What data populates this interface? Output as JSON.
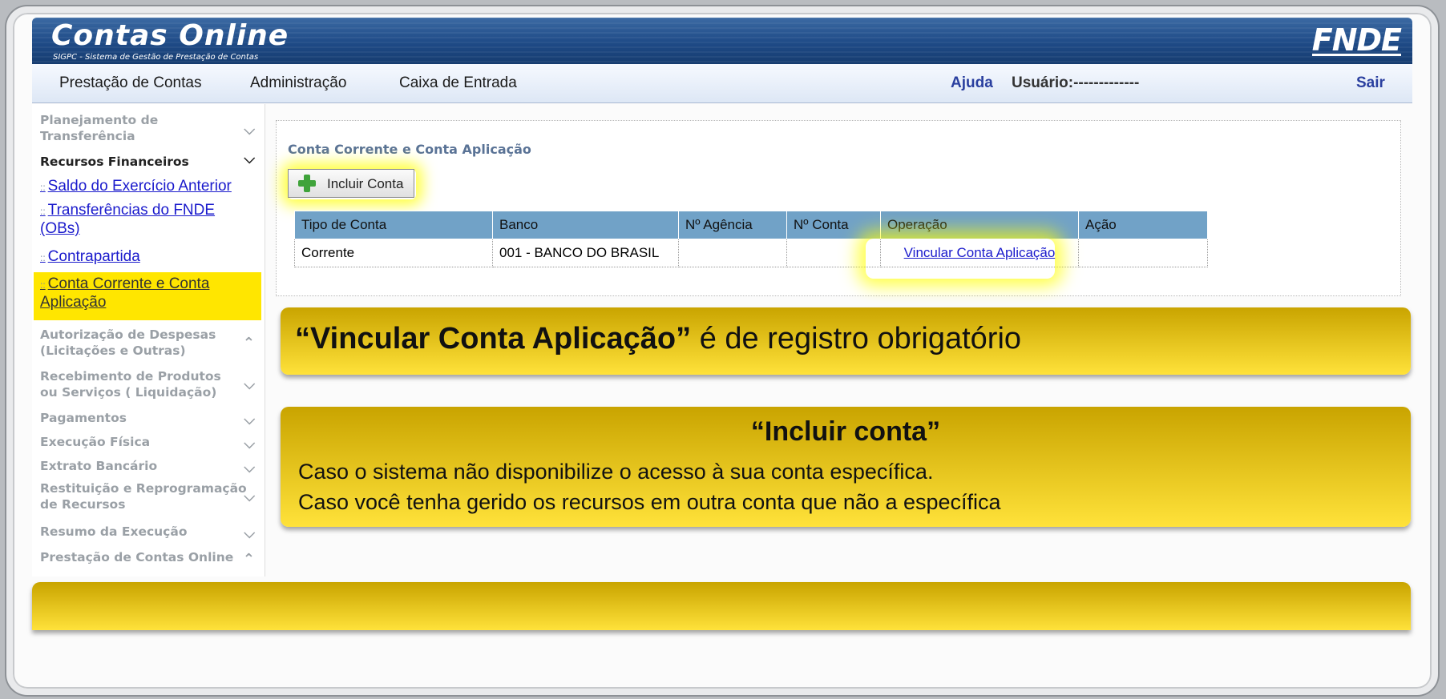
{
  "header": {
    "title": "Contas Online",
    "subtitle": "SIGPC - Sistema de Gestão de Prestação de Contas",
    "logo": "FNDE"
  },
  "menu": {
    "items": [
      "Prestação de Contas",
      "Administração",
      "Caixa de Entrada"
    ],
    "help": "Ajuda",
    "user_label": "Usuário:-------------",
    "logout": "Sair"
  },
  "sidebar": {
    "sections": [
      {
        "label": "Planejamento de Transferência",
        "icon": "chevron-double-down-icon"
      },
      {
        "label": "Recursos Financeiros",
        "icon": "chevron-double-down-icon"
      },
      {
        "label": "Autorização de Despesas (Licitações e Outras)",
        "icon": "chevron-double-up-icon"
      },
      {
        "label": "Recebimento de Produtos ou Serviços ( Liquidação)",
        "icon": "chevron-double-down-icon"
      },
      {
        "label": "Pagamentos",
        "icon": "chevron-double-down-icon"
      },
      {
        "label": "Execução Física",
        "icon": "chevron-double-down-icon"
      },
      {
        "label": "Extrato Bancário",
        "icon": "chevron-double-down-icon"
      },
      {
        "label": "Restituição e Reprogramação de Recursos",
        "icon": "chevron-double-down-icon"
      },
      {
        "label": "Resumo da Execução",
        "icon": "chevron-double-down-icon"
      },
      {
        "label": "Prestação de Contas Online",
        "icon": "chevron-double-up-icon"
      }
    ],
    "sub_items": [
      "Saldo do Exercício Anterior",
      "Transferências do FNDE (OBs)",
      "Contrapartida",
      "Conta Corrente e Conta Aplicação"
    ]
  },
  "content": {
    "title": "Conta Corrente e Conta Aplicação",
    "add_button": "Incluir Conta",
    "table": {
      "headers": [
        "Tipo de Conta",
        "Banco",
        "Nº Agência",
        "Nº Conta",
        "Operação",
        "Ação"
      ],
      "rows": [
        {
          "tipo": "Corrente",
          "banco": "001 - BANCO DO BRASIL",
          "agencia": "",
          "conta": "",
          "operacao": "Vincular Conta Aplicação",
          "acao": ""
        }
      ]
    }
  },
  "callouts": {
    "c1_bold": "“Vincular Conta Aplicação”",
    "c1_rest": " é de registro obrigatório",
    "c2_title": "“Incluir conta”",
    "c2_line1": "Caso o sistema não disponibilize o acesso à sua conta específica.",
    "c2_line2": "Caso você tenha gerido os recursos em outra conta que não a específica"
  },
  "colors": {
    "header_blue": "#1e4a86",
    "callout_gold": "#e8c41a",
    "highlight_yellow": "#ffe600",
    "link_blue": "#1a1acc"
  }
}
